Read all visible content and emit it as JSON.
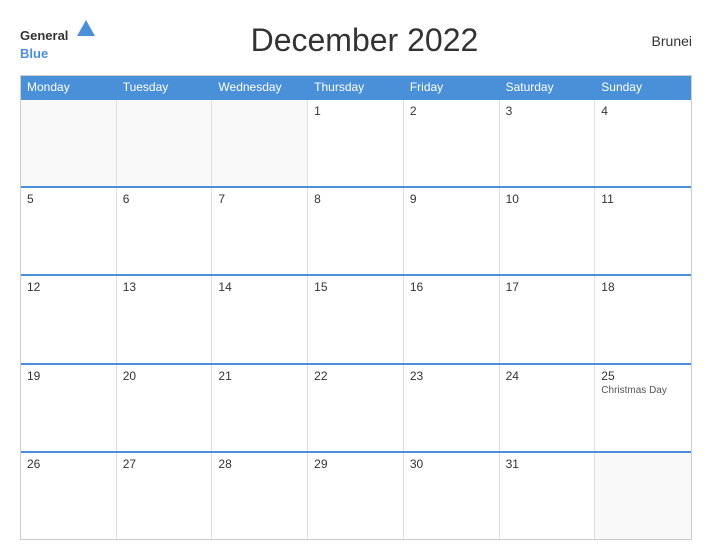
{
  "header": {
    "logo_general": "General",
    "logo_blue": "Blue",
    "title": "December 2022",
    "country": "Brunei"
  },
  "days": {
    "headers": [
      "Monday",
      "Tuesday",
      "Wednesday",
      "Thursday",
      "Friday",
      "Saturday",
      "Sunday"
    ]
  },
  "weeks": [
    [
      {
        "number": "",
        "empty": true
      },
      {
        "number": "",
        "empty": true
      },
      {
        "number": "",
        "empty": true
      },
      {
        "number": "1",
        "empty": false
      },
      {
        "number": "2",
        "empty": false
      },
      {
        "number": "3",
        "empty": false
      },
      {
        "number": "4",
        "empty": false
      }
    ],
    [
      {
        "number": "5",
        "empty": false
      },
      {
        "number": "6",
        "empty": false
      },
      {
        "number": "7",
        "empty": false
      },
      {
        "number": "8",
        "empty": false
      },
      {
        "number": "9",
        "empty": false
      },
      {
        "number": "10",
        "empty": false
      },
      {
        "number": "11",
        "empty": false
      }
    ],
    [
      {
        "number": "12",
        "empty": false
      },
      {
        "number": "13",
        "empty": false
      },
      {
        "number": "14",
        "empty": false
      },
      {
        "number": "15",
        "empty": false
      },
      {
        "number": "16",
        "empty": false
      },
      {
        "number": "17",
        "empty": false
      },
      {
        "number": "18",
        "empty": false
      }
    ],
    [
      {
        "number": "19",
        "empty": false
      },
      {
        "number": "20",
        "empty": false
      },
      {
        "number": "21",
        "empty": false
      },
      {
        "number": "22",
        "empty": false
      },
      {
        "number": "23",
        "empty": false
      },
      {
        "number": "24",
        "empty": false
      },
      {
        "number": "25",
        "holiday": "Christmas Day",
        "empty": false
      }
    ],
    [
      {
        "number": "26",
        "empty": false
      },
      {
        "number": "27",
        "empty": false
      },
      {
        "number": "28",
        "empty": false
      },
      {
        "number": "29",
        "empty": false
      },
      {
        "number": "30",
        "empty": false
      },
      {
        "number": "31",
        "empty": false
      },
      {
        "number": "",
        "empty": true
      }
    ]
  ]
}
